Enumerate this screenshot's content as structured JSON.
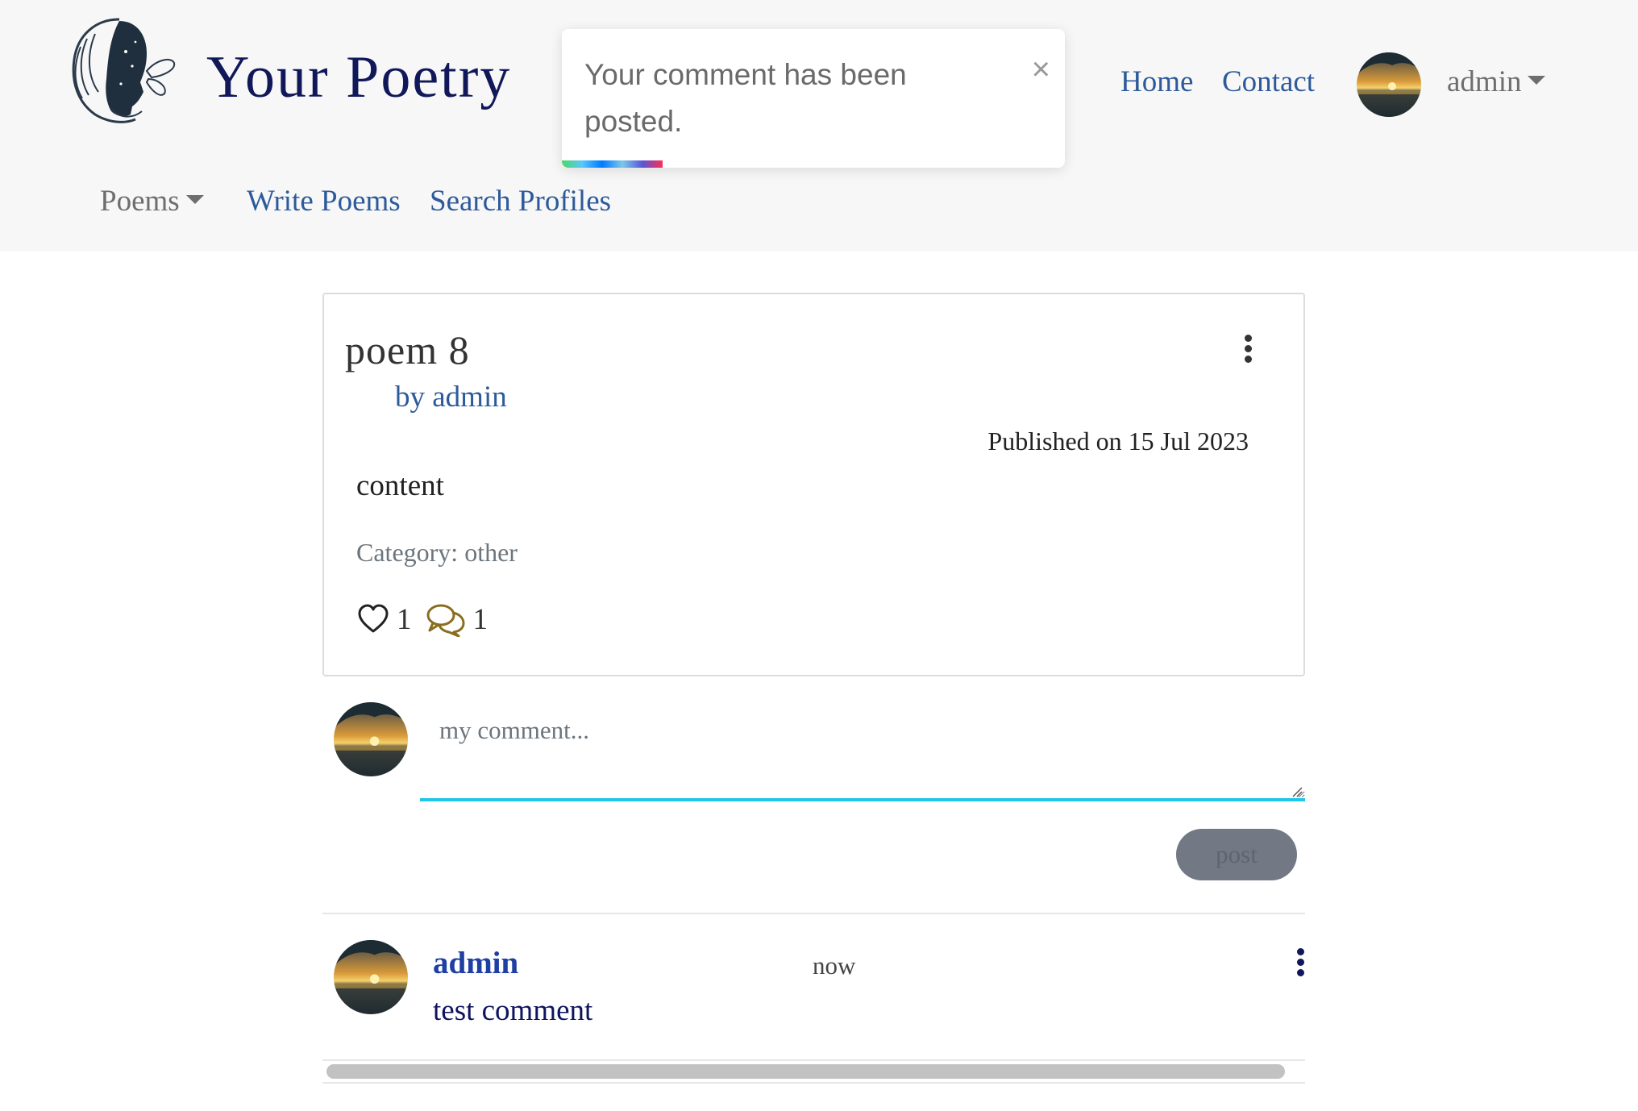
{
  "header": {
    "brand": "Your Poetry",
    "nav": {
      "home": "Home",
      "contact": "Contact",
      "user": "admin",
      "poems": "Poems",
      "write": "Write Poems",
      "search": "Search Profiles"
    }
  },
  "toast": {
    "message": "Your comment has been posted.",
    "close": "×",
    "progress": 0.2,
    "gradient_colors": [
      "#4cd964",
      "#5ac8fa",
      "#007aff",
      "#5856d6",
      "#ff2d55"
    ]
  },
  "poem": {
    "title": "poem 8",
    "author": "by admin",
    "published": "Published on 15 Jul 2023",
    "content": "content",
    "category": "Category: other",
    "likes": "1",
    "comments": "1",
    "icons": [
      "kebab-menu-icon",
      "heart-icon",
      "chat-bubbles-icon"
    ]
  },
  "comment_form": {
    "placeholder": "my comment...",
    "post_label": "post"
  },
  "comments": [
    {
      "author": "admin",
      "time": "now",
      "text": "test comment"
    }
  ],
  "colors": {
    "brand": "#10185a",
    "link": "#2c5a9a",
    "comment_author": "#1e3fa3",
    "input_underline": "#1ec6e8",
    "chat_icon": "#8a6d1e",
    "post_button": "#727884"
  }
}
